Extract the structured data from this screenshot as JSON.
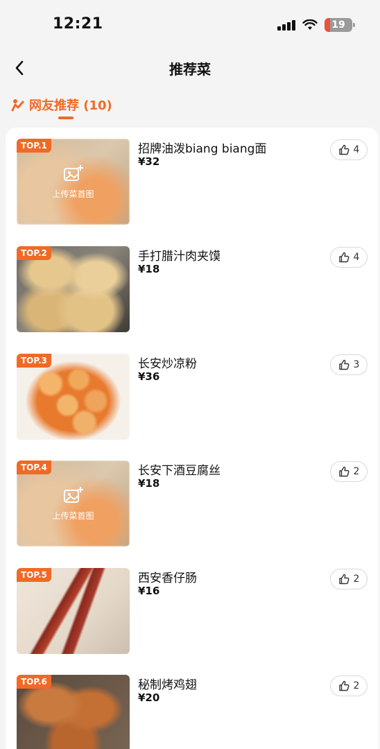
{
  "status": {
    "time": "12:21",
    "battery": "19"
  },
  "nav": {
    "title": "推荐菜"
  },
  "tabs": [
    {
      "label": "网友推荐 (10)",
      "active": true
    }
  ],
  "colors": {
    "accent": "#f06a26"
  },
  "dishes": [
    {
      "rank": "TOP.1",
      "name": "招牌油泼biang biang面",
      "price": "¥32",
      "likes": "4",
      "has_photo": false,
      "upload_label": "上传菜首图"
    },
    {
      "rank": "TOP.2",
      "name": "手打腊汁肉夹馍",
      "price": "¥18",
      "likes": "4",
      "has_photo": true
    },
    {
      "rank": "TOP.3",
      "name": "长安炒凉粉",
      "price": "¥36",
      "likes": "3",
      "has_photo": true
    },
    {
      "rank": "TOP.4",
      "name": "长安下酒豆腐丝",
      "price": "¥18",
      "likes": "2",
      "has_photo": false,
      "upload_label": "上传菜首图"
    },
    {
      "rank": "TOP.5",
      "name": "西安香仔肠",
      "price": "¥16",
      "likes": "2",
      "has_photo": true
    },
    {
      "rank": "TOP.6",
      "name": "秘制烤鸡翅",
      "price": "¥20",
      "likes": "2",
      "has_photo": true
    }
  ]
}
